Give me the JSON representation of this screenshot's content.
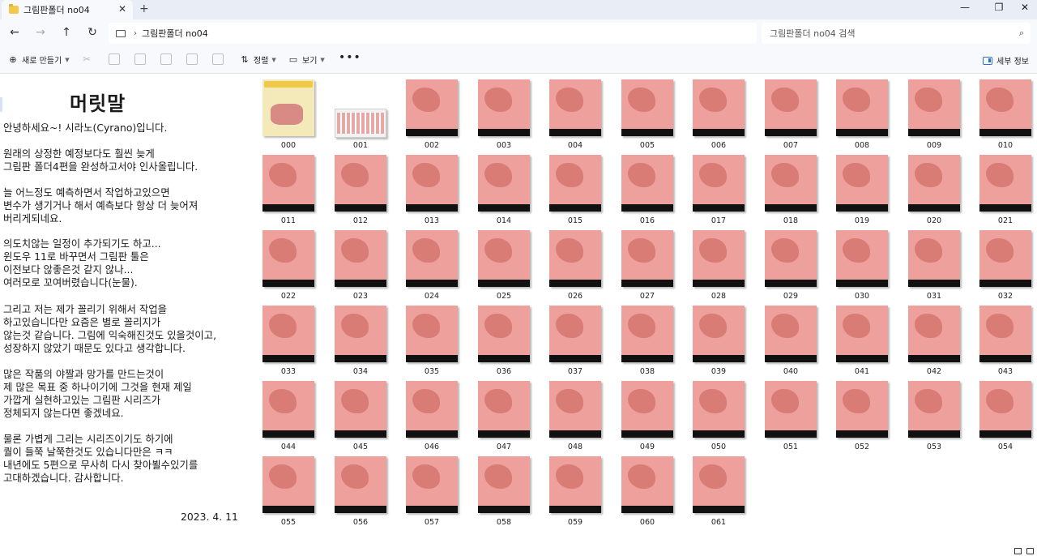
{
  "window": {
    "tab_title": "그림판폴더 no04",
    "tab_close": "✕",
    "new_tab": "+",
    "minimize": "—",
    "maximize": "❐",
    "close": "✕"
  },
  "address": {
    "path": "그림판폴더 no04",
    "search_placeholder": "그림판폴더 no04 검색"
  },
  "toolbar": {
    "new_label": "새로 만들기",
    "sort_label": "정렬",
    "view_label": "보기",
    "more": "•••",
    "details_label": "세부 정보"
  },
  "text_file": {
    "heading": "머릿말",
    "lines": [
      "안녕하세요~! 시라노(Cyrano)입니다.",
      "원래의 상정한 예정보다도 훨씬 늦게",
      "그림판 폴더4편을 완성하고서야 인사올립니다.",
      "늘 어느정도 예측하면서 작업하고있으면",
      "변수가 생기거나 해서 예측보다 항상 더 늦어져",
      "버리게되네요.",
      "의도치않는 일정이 추가되기도 하고...",
      "윈도우 11로 바꾸면서 그림판 툴은",
      "이전보다 않좋은것 같지 않나...",
      "여러모로 꼬여버렸습니다(눈물).",
      "그리고 저는 제가 꼴리기 위해서 작업을",
      "하고있습니다만 요즘은 별로 꼴리지가",
      "않는것 같습니다. 그림에 익숙해진것도 있을것이고,",
      "성장하지 않았기 때문도 있다고 생각합니다.",
      "많은 작품의 야짤과 망가를 만드는것이",
      "제 많은 목표 중 하나이기에 그것을 현재 제일",
      "가깝게 실현하고있는 그림판 시리즈가",
      "정체되지 않는다면 좋겠네요.",
      "물론 가볍게 그리는 시리즈이기도 하기에",
      "퀄이 들쭉 날쭉한것도 있습니다만은 ㅋㅋ",
      "내년에도 5편으로 무사히 다시 찾아뵐수있기를",
      "고대하겠습니다. 감사합니다."
    ],
    "date": "2023. 4. 11"
  },
  "files": [
    "000",
    "001",
    "002",
    "003",
    "004",
    "005",
    "006",
    "007",
    "008",
    "009",
    "010",
    "011",
    "012",
    "013",
    "014",
    "015",
    "016",
    "017",
    "018",
    "019",
    "020",
    "021",
    "022",
    "023",
    "024",
    "025",
    "026",
    "027",
    "028",
    "029",
    "030",
    "031",
    "032",
    "033",
    "034",
    "035",
    "036",
    "037",
    "038",
    "039",
    "040",
    "041",
    "042",
    "043",
    "044",
    "045",
    "046",
    "047",
    "048",
    "049",
    "050",
    "051",
    "052",
    "053",
    "054",
    "055",
    "056",
    "057",
    "058",
    "059",
    "060",
    "061"
  ]
}
